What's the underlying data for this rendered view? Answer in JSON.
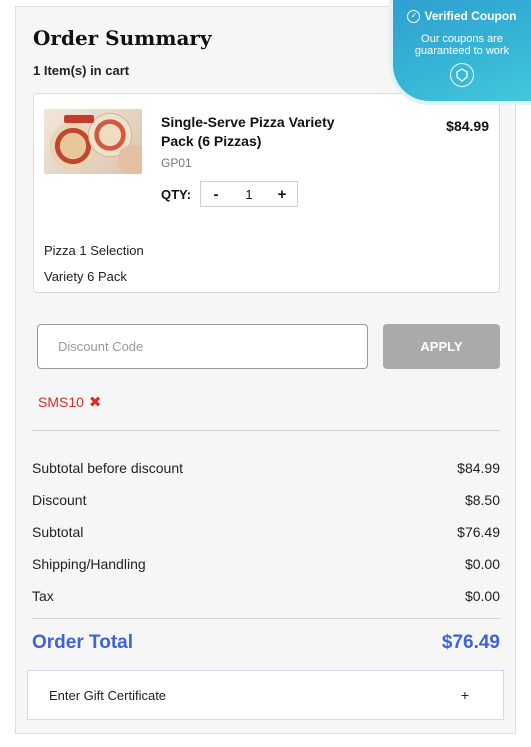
{
  "summary": {
    "title": "Order Summary",
    "items_count": "1 Item(s) in cart"
  },
  "item": {
    "name": "Single-Serve Pizza Variety Pack (6 Pizzas)",
    "sku": "GP01",
    "price": "$84.99",
    "qty_label": "QTY:",
    "qty_minus": "-",
    "qty_value": "1",
    "qty_plus": "+",
    "options": [
      "Pizza 1 Selection",
      "Variety 6 Pack"
    ]
  },
  "discount": {
    "placeholder": "Discount Code",
    "apply_label": "APPLY",
    "applied_code": "SMS10",
    "remove_symbol": "✖"
  },
  "totals": {
    "rows": [
      {
        "label": "Subtotal before discount",
        "value": "$84.99"
      },
      {
        "label": "Discount",
        "value": "$8.50"
      },
      {
        "label": "Subtotal",
        "value": "$76.49"
      },
      {
        "label": "Shipping/Handling",
        "value": "$0.00"
      },
      {
        "label": "Tax",
        "value": "$0.00"
      }
    ],
    "order_total_label": "Order Total",
    "order_total_value": "$76.49"
  },
  "gift": {
    "label": "Enter Gift Certificate",
    "plus": "+"
  },
  "verified": {
    "title": "Verified Coupon",
    "subtitle": "Our coupons are guaranteed to work",
    "check_icon": "check-circle-icon",
    "badge_icon": "badge-icon"
  },
  "colors": {
    "accent": "#3f63d6",
    "coupon_red": "#d0312d",
    "apply_gray": "#aaaaaa",
    "verified_blue": "#37b6d6"
  }
}
